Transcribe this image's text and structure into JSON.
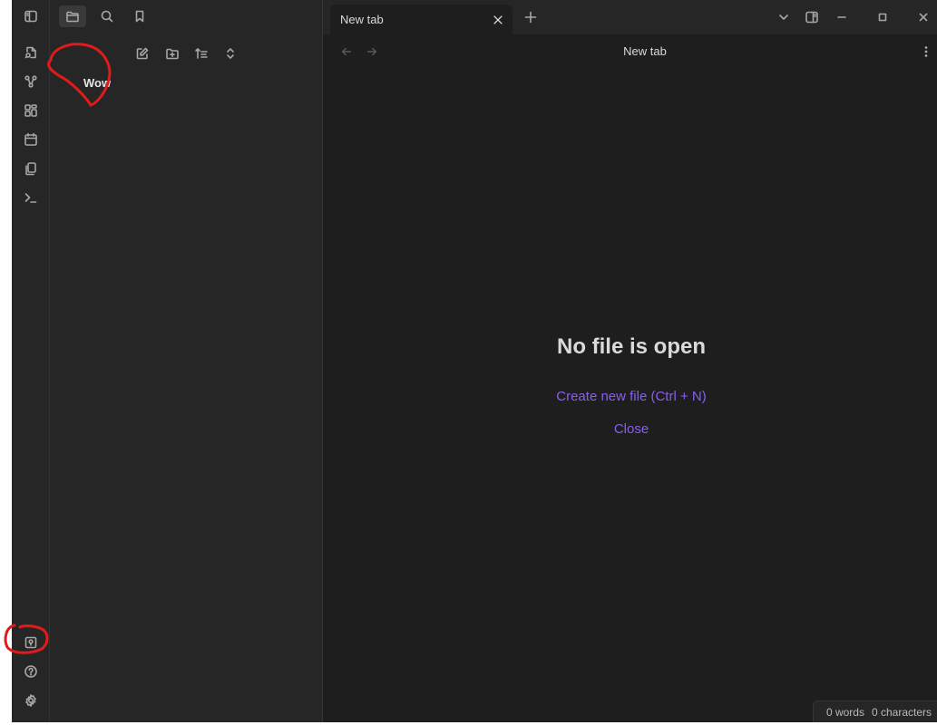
{
  "sidebar": {
    "vault_name": "Wow"
  },
  "tabs": [
    {
      "label": "New tab"
    }
  ],
  "view": {
    "title": "New tab"
  },
  "empty_state": {
    "title": "No file is open",
    "create_action": "Create new file (Ctrl + N)",
    "close_action": "Close"
  },
  "status_bar": {
    "words": "0 words",
    "characters": "0 characters"
  },
  "colors": {
    "accent": "#8a5cf5",
    "annotation": "#e01b1b",
    "background": "#1e1e1e",
    "sidebar": "#262626"
  },
  "icons": {
    "ribbon_top": [
      "open-quick-switcher-icon",
      "graph-view-icon",
      "canvas-icon",
      "daily-note-icon",
      "templates-icon",
      "command-palette-icon"
    ],
    "ribbon_bottom": [
      "vault-switcher-icon",
      "help-icon",
      "settings-icon"
    ]
  }
}
